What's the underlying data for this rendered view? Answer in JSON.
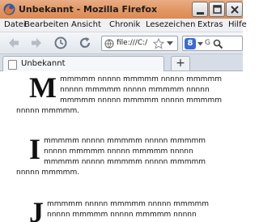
{
  "window": {
    "title": "Unbekannt - Mozilla Firefox"
  },
  "menubar": {
    "items": [
      "Datei",
      "Bearbeiten",
      "Ansicht",
      "Chronik",
      "Lesezeichen",
      "Extras",
      "Hilfe"
    ]
  },
  "navbar": {
    "url": "file:///C:/",
    "search_hint": "G"
  },
  "tabs": [
    {
      "label": "Unbekannt"
    }
  ],
  "newtab_label": "+",
  "content": {
    "paragraphs": [
      {
        "initial": "M",
        "text": "mmmmm nnnnn mmmmm nnnnn mmmmm nnnnn mmmmm nnnnn mmmmm nnnnn mmmmm nnnnn mmmmm nnnnn mmmmm nnnnn mmmmm."
      },
      {
        "initial": "I",
        "text": "mmmmm nnnnn mmmmm nnnnn mmmmm nnnnn mmmmm nnnnn mmmmm nnnnn mmmmm nnnnn mmmmm nnnnn mmmmm nnnnn mmmmm."
      },
      {
        "initial": "J",
        "text": "mmmmm nnnnn mmmmm nnnnn mmmmm nnnnn mmmmm nnnnn mmmmm nnnnn"
      }
    ]
  },
  "colors": {
    "titlebar": "#e39a67",
    "background": "#ffffff"
  }
}
